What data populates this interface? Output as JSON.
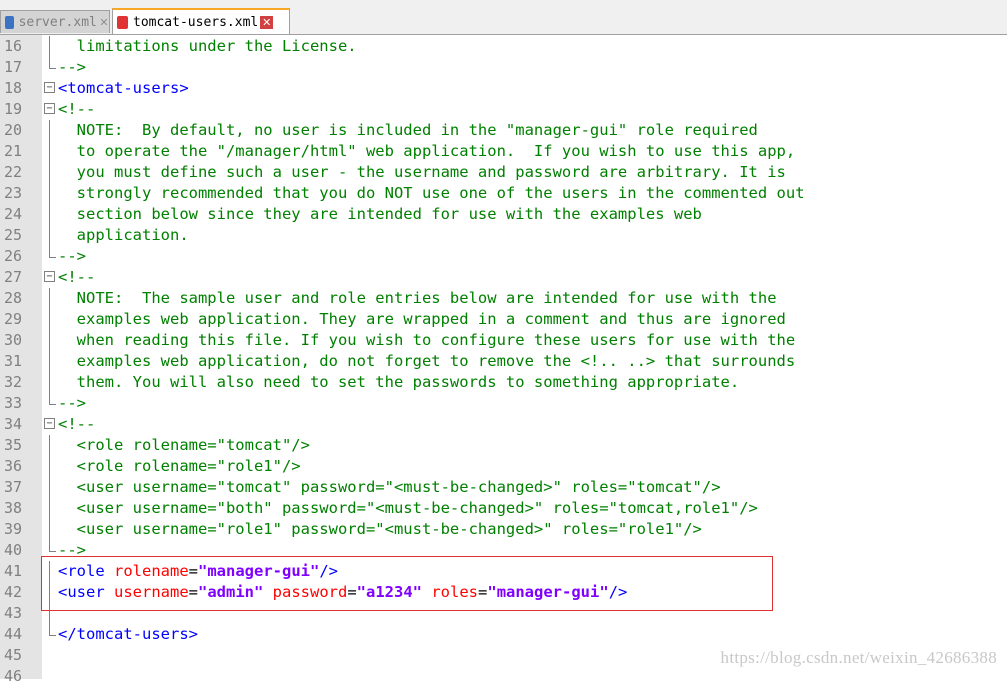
{
  "tabs": [
    {
      "label": "server.xml",
      "active": false
    },
    {
      "label": "tomcat-users.xml",
      "active": true
    }
  ],
  "lines": [
    {
      "n": "16",
      "fold": "line",
      "tokens": [
        {
          "t": "  limitations under the License.",
          "c": "c"
        }
      ]
    },
    {
      "n": "17",
      "fold": "end",
      "tokens": [
        {
          "t": "-->",
          "c": "c"
        }
      ]
    },
    {
      "n": "18",
      "fold": "box",
      "tokens": [
        {
          "t": "<tomcat-users>",
          "c": "t"
        }
      ]
    },
    {
      "n": "19",
      "fold": "box",
      "tokens": [
        {
          "t": "<!--",
          "c": "c"
        }
      ]
    },
    {
      "n": "20",
      "fold": "line",
      "tokens": [
        {
          "t": "  NOTE:  By default, no user is included in the \"manager-gui\" role required",
          "c": "c"
        }
      ]
    },
    {
      "n": "21",
      "fold": "line",
      "tokens": [
        {
          "t": "  to operate the \"/manager/html\" web application.  If you wish to use this app,",
          "c": "c"
        }
      ]
    },
    {
      "n": "22",
      "fold": "line",
      "tokens": [
        {
          "t": "  you must define such a user - the username and password are arbitrary. It is",
          "c": "c"
        }
      ]
    },
    {
      "n": "23",
      "fold": "line",
      "tokens": [
        {
          "t": "  strongly recommended that you do NOT use one of the users in the commented out",
          "c": "c"
        }
      ]
    },
    {
      "n": "24",
      "fold": "line",
      "tokens": [
        {
          "t": "  section below since they are intended for use with the examples web",
          "c": "c"
        }
      ]
    },
    {
      "n": "25",
      "fold": "line",
      "tokens": [
        {
          "t": "  application.",
          "c": "c"
        }
      ]
    },
    {
      "n": "26",
      "fold": "end",
      "tokens": [
        {
          "t": "-->",
          "c": "c"
        }
      ]
    },
    {
      "n": "27",
      "fold": "box",
      "tokens": [
        {
          "t": "<!--",
          "c": "c"
        }
      ]
    },
    {
      "n": "28",
      "fold": "line",
      "tokens": [
        {
          "t": "  NOTE:  The sample user and role entries below are intended for use with the",
          "c": "c"
        }
      ]
    },
    {
      "n": "29",
      "fold": "line",
      "tokens": [
        {
          "t": "  examples web application. They are wrapped in a comment and thus are ignored",
          "c": "c"
        }
      ]
    },
    {
      "n": "30",
      "fold": "line",
      "tokens": [
        {
          "t": "  when reading this file. If you wish to configure these users for use with the",
          "c": "c"
        }
      ]
    },
    {
      "n": "31",
      "fold": "line",
      "tokens": [
        {
          "t": "  examples web application, do not forget to remove the <!.. ..> that surrounds",
          "c": "c"
        }
      ]
    },
    {
      "n": "32",
      "fold": "line",
      "tokens": [
        {
          "t": "  them. You will also need to set the passwords to something appropriate.",
          "c": "c"
        }
      ]
    },
    {
      "n": "33",
      "fold": "end",
      "tokens": [
        {
          "t": "-->",
          "c": "c"
        }
      ]
    },
    {
      "n": "34",
      "fold": "box",
      "tokens": [
        {
          "t": "<!--",
          "c": "c"
        }
      ]
    },
    {
      "n": "35",
      "fold": "line",
      "tokens": [
        {
          "t": "  <role rolename=\"tomcat\"/>",
          "c": "c"
        }
      ]
    },
    {
      "n": "36",
      "fold": "line",
      "tokens": [
        {
          "t": "  <role rolename=\"role1\"/>",
          "c": "c"
        }
      ]
    },
    {
      "n": "37",
      "fold": "line",
      "tokens": [
        {
          "t": "  <user username=\"tomcat\" password=\"<must-be-changed>\" roles=\"tomcat\"/>",
          "c": "c"
        }
      ]
    },
    {
      "n": "38",
      "fold": "line",
      "tokens": [
        {
          "t": "  <user username=\"both\" password=\"<must-be-changed>\" roles=\"tomcat,role1\"/>",
          "c": "c"
        }
      ]
    },
    {
      "n": "39",
      "fold": "line",
      "tokens": [
        {
          "t": "  <user username=\"role1\" password=\"<must-be-changed>\" roles=\"role1\"/>",
          "c": "c"
        }
      ]
    },
    {
      "n": "40",
      "fold": "end",
      "tokens": [
        {
          "t": "-->",
          "c": "c"
        }
      ]
    },
    {
      "n": "41",
      "fold": "line",
      "tokens": [
        {
          "t": "<role ",
          "c": "t"
        },
        {
          "t": "rolename",
          "c": "a"
        },
        {
          "t": "=",
          "c": "p"
        },
        {
          "t": "\"manager-gui\"",
          "c": "s"
        },
        {
          "t": "/>",
          "c": "t"
        }
      ]
    },
    {
      "n": "42",
      "fold": "line",
      "tokens": [
        {
          "t": "<user ",
          "c": "t"
        },
        {
          "t": "username",
          "c": "a"
        },
        {
          "t": "=",
          "c": "p"
        },
        {
          "t": "\"admin\"",
          "c": "s"
        },
        {
          "t": " ",
          "c": "p"
        },
        {
          "t": "password",
          "c": "a"
        },
        {
          "t": "=",
          "c": "p"
        },
        {
          "t": "\"a1234\"",
          "c": "s"
        },
        {
          "t": " ",
          "c": "p"
        },
        {
          "t": "roles",
          "c": "a"
        },
        {
          "t": "=",
          "c": "p"
        },
        {
          "t": "\"manager-gui\"",
          "c": "s"
        },
        {
          "t": "/>",
          "c": "t"
        }
      ]
    },
    {
      "n": "43",
      "fold": "line",
      "tokens": []
    },
    {
      "n": "44",
      "fold": "end",
      "tokens": [
        {
          "t": "</tomcat-users>",
          "c": "t"
        }
      ]
    },
    {
      "n": "45",
      "fold": "none",
      "tokens": []
    },
    {
      "n": "46",
      "fold": "none",
      "tokens": []
    }
  ],
  "watermark": "https://blog.csdn.net/weixin_42686388",
  "colors": {
    "comment": "#008000",
    "tag": "#0000ff",
    "attr": "#ff0000",
    "value": "#8000ff",
    "highlight_box": "#e03030"
  }
}
